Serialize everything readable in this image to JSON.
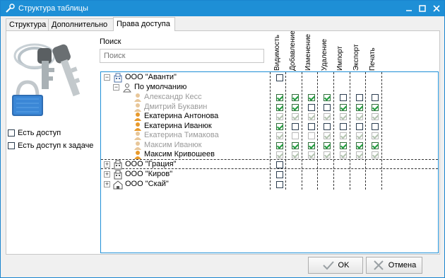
{
  "window": {
    "title": "Структура таблицы"
  },
  "tabs": [
    {
      "label": "Структура",
      "active": false
    },
    {
      "label": "Дополнительно",
      "active": false
    },
    {
      "label": "Права доступа",
      "active": true
    }
  ],
  "left": {
    "has_access_label": "Есть доступ",
    "has_access_checked": false,
    "has_task_access_label": "Есть доступ к задаче",
    "has_task_access_checked": false
  },
  "search": {
    "label": "Поиск",
    "placeholder": "Поиск",
    "value": ""
  },
  "columns": [
    "Видимость",
    "Добавление",
    "Изменение",
    "Удаление",
    "Импорт",
    "Экспорт",
    "Печать"
  ],
  "tree": [
    {
      "label": "ООО \"Аванти\"",
      "type": "org",
      "expander": "-",
      "dim": false,
      "checks": [
        false
      ]
    },
    {
      "label": "По умолчанию",
      "type": "group",
      "expander": "-",
      "dim": false,
      "checks": []
    },
    {
      "label": "Александр Кесс",
      "type": "user",
      "dim": true,
      "checks": [
        null,
        null,
        null,
        null,
        null,
        null,
        null
      ]
    },
    {
      "label": "Дмитрий Букавин",
      "type": "user",
      "dim": true,
      "checks": [
        true,
        true,
        false,
        false,
        true,
        true,
        true
      ]
    },
    {
      "label": "Екатерина Антонова",
      "type": "user",
      "dim": false,
      "checks": [
        false,
        false,
        false,
        false,
        false,
        false,
        false
      ]
    },
    {
      "label": "Екатерина Иванюк",
      "type": "user",
      "dim": false,
      "checks": [
        true,
        false,
        false,
        false,
        false,
        false,
        false
      ]
    },
    {
      "label": "Екатерина Тимакова",
      "type": "user",
      "dim": true,
      "checks": [
        true,
        false,
        false,
        true,
        true,
        true,
        true
      ]
    },
    {
      "label": "Максим Иванюк",
      "type": "user",
      "dim": true,
      "checks": [
        true,
        false,
        false,
        true,
        false,
        true,
        true
      ]
    },
    {
      "label": "Максим Кривошеев",
      "type": "user",
      "dim": false,
      "checks": [
        false,
        false,
        false,
        false,
        false,
        false,
        false
      ]
    },
    {
      "label": "ООО \"Грация\"",
      "type": "org",
      "expander": "+",
      "dim": false,
      "checks": [
        false
      ]
    },
    {
      "label": "ООО \"Киров\"",
      "type": "org",
      "expander": "+",
      "dim": false,
      "checks": [
        false
      ]
    },
    {
      "label": "ООО \"Скай\"",
      "type": "org",
      "expander": "+",
      "dim": false,
      "checks": [
        false
      ]
    }
  ],
  "grid_checks": {
    "r2": [
      true,
      true,
      true,
      true,
      false,
      false,
      false
    ],
    "r3": [
      true,
      true,
      false,
      false,
      true,
      true,
      true
    ],
    "r4": [
      true,
      true,
      true,
      true,
      true,
      true,
      true
    ],
    "r5": [
      true,
      false,
      false,
      false,
      false,
      false,
      false
    ],
    "r6": [
      true,
      false,
      false,
      true,
      true,
      true,
      true
    ],
    "r7": [
      true,
      true,
      true,
      true,
      true,
      true,
      true
    ],
    "r8": [
      true,
      true,
      true,
      true,
      true,
      true,
      true
    ]
  },
  "buttons": {
    "ok": "OK",
    "cancel": "Отмена"
  },
  "colors": {
    "accent": "#1e8fd6",
    "check": "#1e9b3b"
  }
}
